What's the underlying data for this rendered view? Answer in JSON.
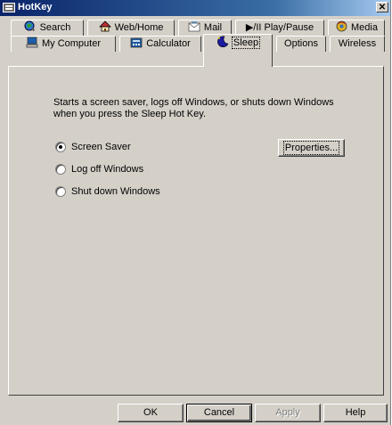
{
  "window": {
    "title": "HotKey",
    "close_label": "✕"
  },
  "tabs_row1": [
    {
      "label": "Search",
      "icon": "magnifier-globe-icon"
    },
    {
      "label": "Web/Home",
      "icon": "web-home-icon"
    },
    {
      "label": "Mail",
      "icon": "mail-icon"
    },
    {
      "label": "▶/II Play/Pause",
      "icon": "play-pause-icon"
    },
    {
      "label": "Media",
      "icon": "media-icon"
    }
  ],
  "tabs_row2": [
    {
      "label": "My Computer",
      "icon": "computer-icon"
    },
    {
      "label": "Calculator",
      "icon": "calculator-icon"
    },
    {
      "label": "Sleep",
      "icon": "sleep-icon",
      "active": true
    },
    {
      "label": "Options"
    },
    {
      "label": "Wireless"
    }
  ],
  "sleep": {
    "description": "Starts a screen saver, logs off Windows, or shuts down Windows when you press the Sleep Hot Key.",
    "options": [
      {
        "label": "Screen Saver",
        "selected": true
      },
      {
        "label": "Log off Windows",
        "selected": false
      },
      {
        "label": "Shut down Windows",
        "selected": false
      }
    ],
    "properties_label": "Properties..."
  },
  "footer": {
    "ok_label": "OK",
    "cancel_label": "Cancel",
    "apply_label": "Apply",
    "help_label": "Help"
  }
}
